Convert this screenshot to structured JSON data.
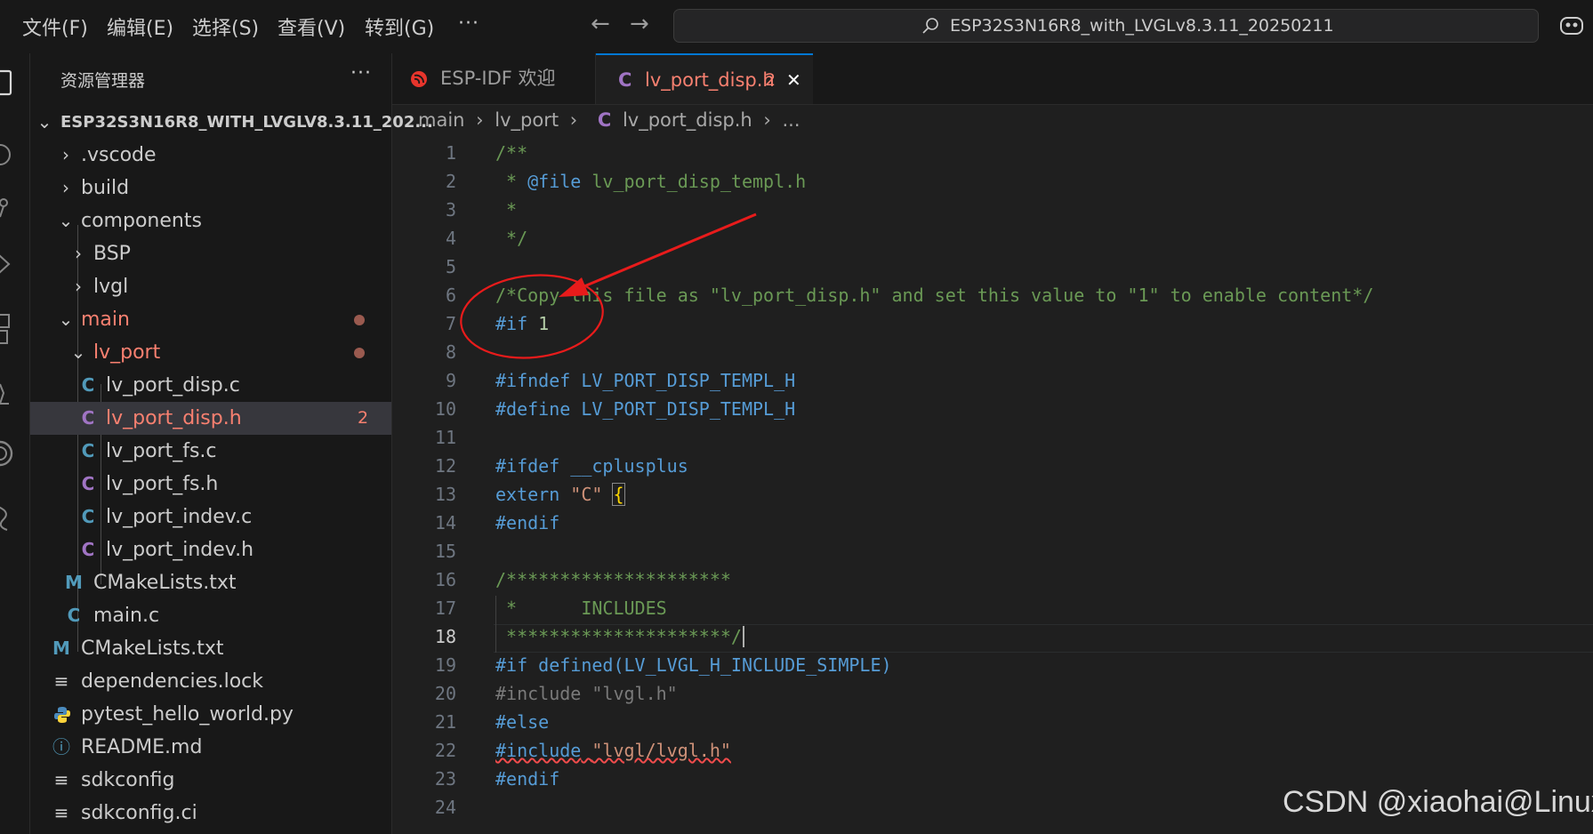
{
  "menu": {
    "items": [
      "文件(F)",
      "编辑(E)",
      "选择(S)",
      "查看(V)",
      "转到(G)"
    ],
    "more": "···"
  },
  "nav": {
    "back_icon": "arrow-left-icon",
    "forward_icon": "arrow-right-icon"
  },
  "search": {
    "text": "ESP32S3N16R8_with_LVGLv8.3.11_20250211"
  },
  "sidebar": {
    "title": "资源管理器",
    "more": "···",
    "items": [
      {
        "label": "ESP32S3N16R8_WITH_LVGLV8.3.11_202..."
      },
      {
        "label": ".vscode"
      },
      {
        "label": "build"
      },
      {
        "label": "components"
      },
      {
        "label": "BSP"
      },
      {
        "label": "lvgl"
      },
      {
        "label": "main"
      },
      {
        "label": "lv_port"
      },
      {
        "label": "lv_port_disp.c",
        "icon": "C"
      },
      {
        "label": "lv_port_disp.h",
        "icon": "C",
        "problems": "2"
      },
      {
        "label": "lv_port_fs.c",
        "icon": "C"
      },
      {
        "label": "lv_port_fs.h",
        "icon": "C"
      },
      {
        "label": "lv_port_indev.c",
        "icon": "C"
      },
      {
        "label": "lv_port_indev.h",
        "icon": "C"
      },
      {
        "label": "CMakeLists.txt",
        "icon": "M"
      },
      {
        "label": "main.c",
        "icon": "C"
      },
      {
        "label": "CMakeLists.txt",
        "icon": "M"
      },
      {
        "label": "dependencies.lock",
        "icon": "≡"
      },
      {
        "label": "pytest_hello_world.py",
        "icon": "python-icon"
      },
      {
        "label": "README.md",
        "icon": "ⓘ"
      },
      {
        "label": "sdkconfig",
        "icon": "≡"
      },
      {
        "label": "sdkconfig.ci",
        "icon": "≡"
      }
    ]
  },
  "tabs": [
    {
      "label": "ESP-IDF 欢迎"
    },
    {
      "label": "lv_port_disp.h",
      "icon": "C",
      "problems": "2",
      "close": "✕"
    }
  ],
  "breadcrumb": {
    "parts": [
      "main",
      "lv_port",
      "lv_port_disp.h",
      "..."
    ],
    "sep": "›",
    "file_icon": "C"
  },
  "editor": {
    "current_line": "18",
    "line_numbers": [
      "1",
      "2",
      "3",
      "4",
      "5",
      "6",
      "7",
      "8",
      "9",
      "10",
      "11",
      "12",
      "13",
      "14",
      "15",
      "16",
      "17",
      "18",
      "19",
      "20",
      "21",
      "22",
      "23",
      "24"
    ],
    "code": {
      "l1": "/**",
      "l2a": " * ",
      "l2b": "@file",
      "l2c": " lv_port_disp_templ.h",
      "l3": " *",
      "l4": " */",
      "l6": "/*Copy this file as \"lv_port_disp.h\" and set this value to \"1\" to enable content*/",
      "l7a": "#if",
      "l7b": "1",
      "l9a": "#ifndef",
      "l9b": "LV_PORT_DISP_TEMPL_H",
      "l10a": "#define",
      "l10b": "LV_PORT_DISP_TEMPL_H",
      "l12a": "#ifdef",
      "l12b": "__cplusplus",
      "l13a": "extern",
      "l13b": "\"C\"",
      "l13c": "{",
      "l14": "#endif",
      "l16": "/*********************",
      "l17": " *      INCLUDES",
      "l18": " *********************/",
      "l19a": "#if",
      "l19b": "defined",
      "l19c": "(LV_LVGL_H_INCLUDE_SIMPLE)",
      "l20a": "#include",
      "l20b": "\"lvgl.h\"",
      "l21": "#else",
      "l22a": "#include",
      "l22b": "\"lvgl/lvgl.h\"",
      "l23": "#endif"
    }
  },
  "annotation": {
    "color": "#e81b1b"
  },
  "watermark": "CSDN @xiaohai@Linux"
}
